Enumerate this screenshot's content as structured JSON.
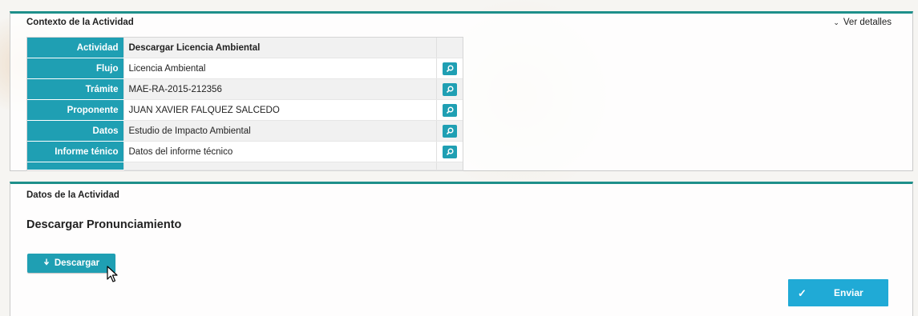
{
  "context_panel": {
    "title": "Contexto de la Actividad",
    "details_toggle": "Ver detalles",
    "rows": [
      {
        "label": "Actividad",
        "value": "Descargar Licencia Ambiental",
        "has_action": false
      },
      {
        "label": "Flujo",
        "value": "Licencia Ambiental",
        "has_action": true
      },
      {
        "label": "Trámite",
        "value": "MAE-RA-2015-212356",
        "has_action": true
      },
      {
        "label": "Proponente",
        "value": "JUAN XAVIER FALQUEZ SALCEDO",
        "has_action": true
      },
      {
        "label": "Datos",
        "value": "Estudio de Impacto Ambiental",
        "has_action": true
      },
      {
        "label": "Informe ténico",
        "value": "Datos del informe técnico",
        "has_action": true
      }
    ],
    "action_icon": "search-icon"
  },
  "activity_panel": {
    "title": "Datos de la Actividad",
    "heading": "Descargar Pronunciamiento",
    "download_button": {
      "label": "Descargar",
      "icon": "download-icon"
    },
    "submit_button": {
      "label": "Enviar",
      "icon": "checkmark-icon"
    }
  },
  "colors": {
    "accent_teal": "#1f9fb3",
    "panel_border_top": "#1e8f8a",
    "submit_blue": "#20aad6"
  }
}
